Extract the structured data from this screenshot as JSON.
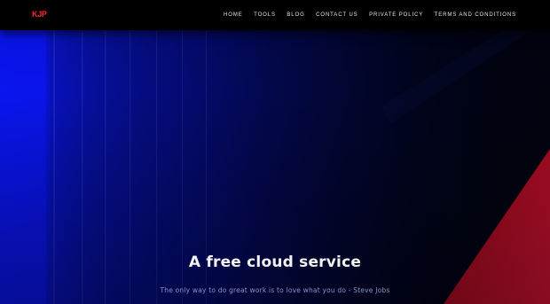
{
  "brand": {
    "logo_text": "KJP",
    "logo_color": "#ff2a2a"
  },
  "nav": {
    "items": [
      {
        "label": "HOME"
      },
      {
        "label": "TOOLS"
      },
      {
        "label": "BLOG"
      },
      {
        "label": "CONTACT US"
      },
      {
        "label": "PRIVATE POLICY"
      },
      {
        "label": "TERMS AND CONDITIONS"
      }
    ]
  },
  "hero": {
    "headline": "A free cloud service",
    "quote": "The only way to do great work is to love what you do - Steve Jobs"
  },
  "colors": {
    "background": "#000000",
    "blue_accent": "#0a16ff",
    "red_accent": "#c0102a"
  }
}
